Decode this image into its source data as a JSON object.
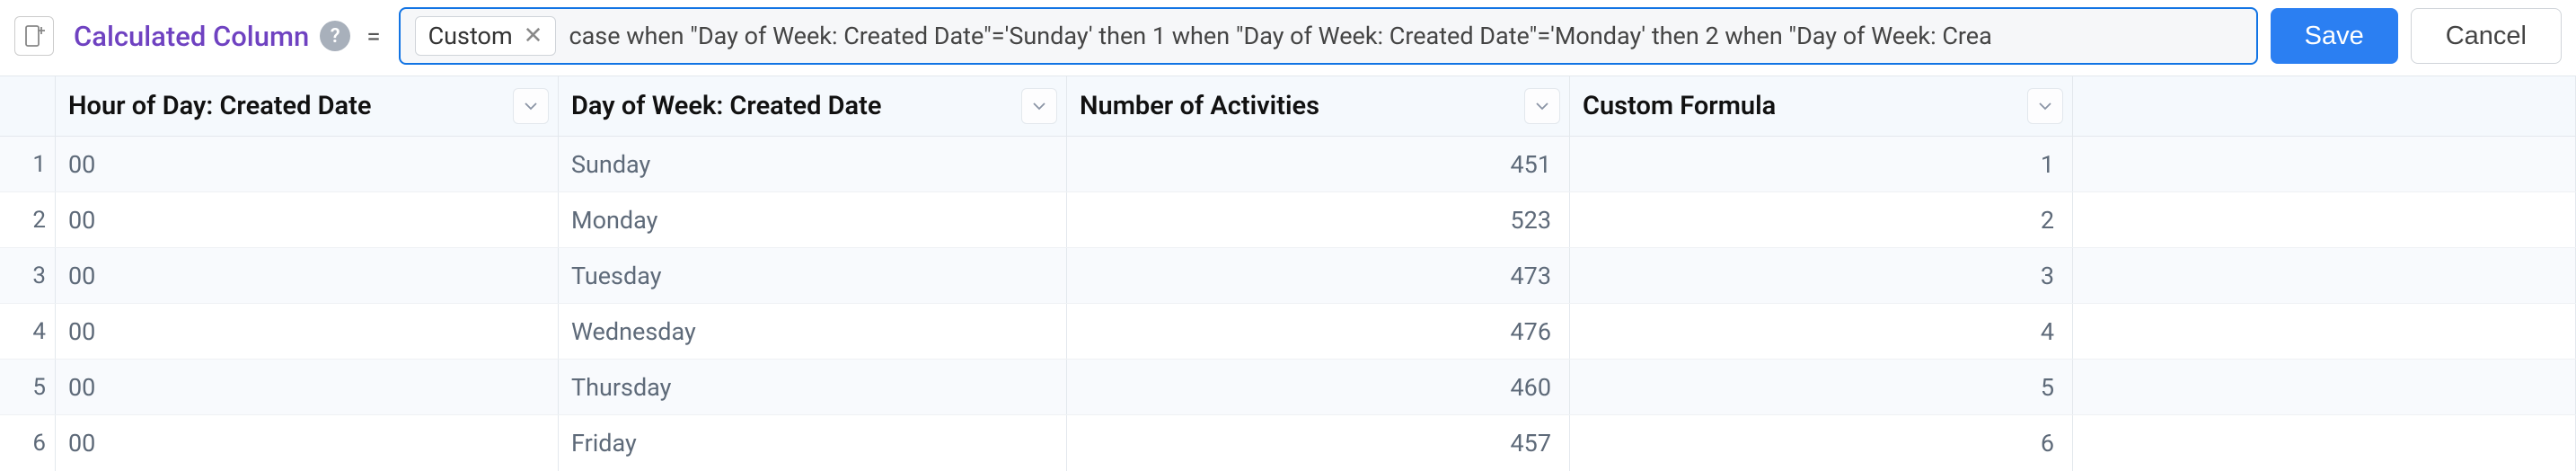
{
  "toolbar": {
    "title": "Calculated Column",
    "chip_label": "Custom",
    "formula_text": "case when \"Day of Week: Created Date\"='Sunday' then 1 when \"Day of Week: Created Date\"='Monday' then 2 when \"Day of Week: Crea",
    "save_label": "Save",
    "cancel_label": "Cancel",
    "equals": "="
  },
  "table": {
    "columns": {
      "hour": "Hour of Day: Created Date",
      "day": "Day of Week: Created Date",
      "activities": "Number of Activities",
      "formula": "Custom Formula"
    },
    "rows": [
      {
        "num": "1",
        "hour": "00",
        "day": "Sunday",
        "activities": "451",
        "formula": "1"
      },
      {
        "num": "2",
        "hour": "00",
        "day": "Monday",
        "activities": "523",
        "formula": "2"
      },
      {
        "num": "3",
        "hour": "00",
        "day": "Tuesday",
        "activities": "473",
        "formula": "3"
      },
      {
        "num": "4",
        "hour": "00",
        "day": "Wednesday",
        "activities": "476",
        "formula": "4"
      },
      {
        "num": "5",
        "hour": "00",
        "day": "Thursday",
        "activities": "460",
        "formula": "5"
      },
      {
        "num": "6",
        "hour": "00",
        "day": "Friday",
        "activities": "457",
        "formula": "6"
      }
    ]
  }
}
